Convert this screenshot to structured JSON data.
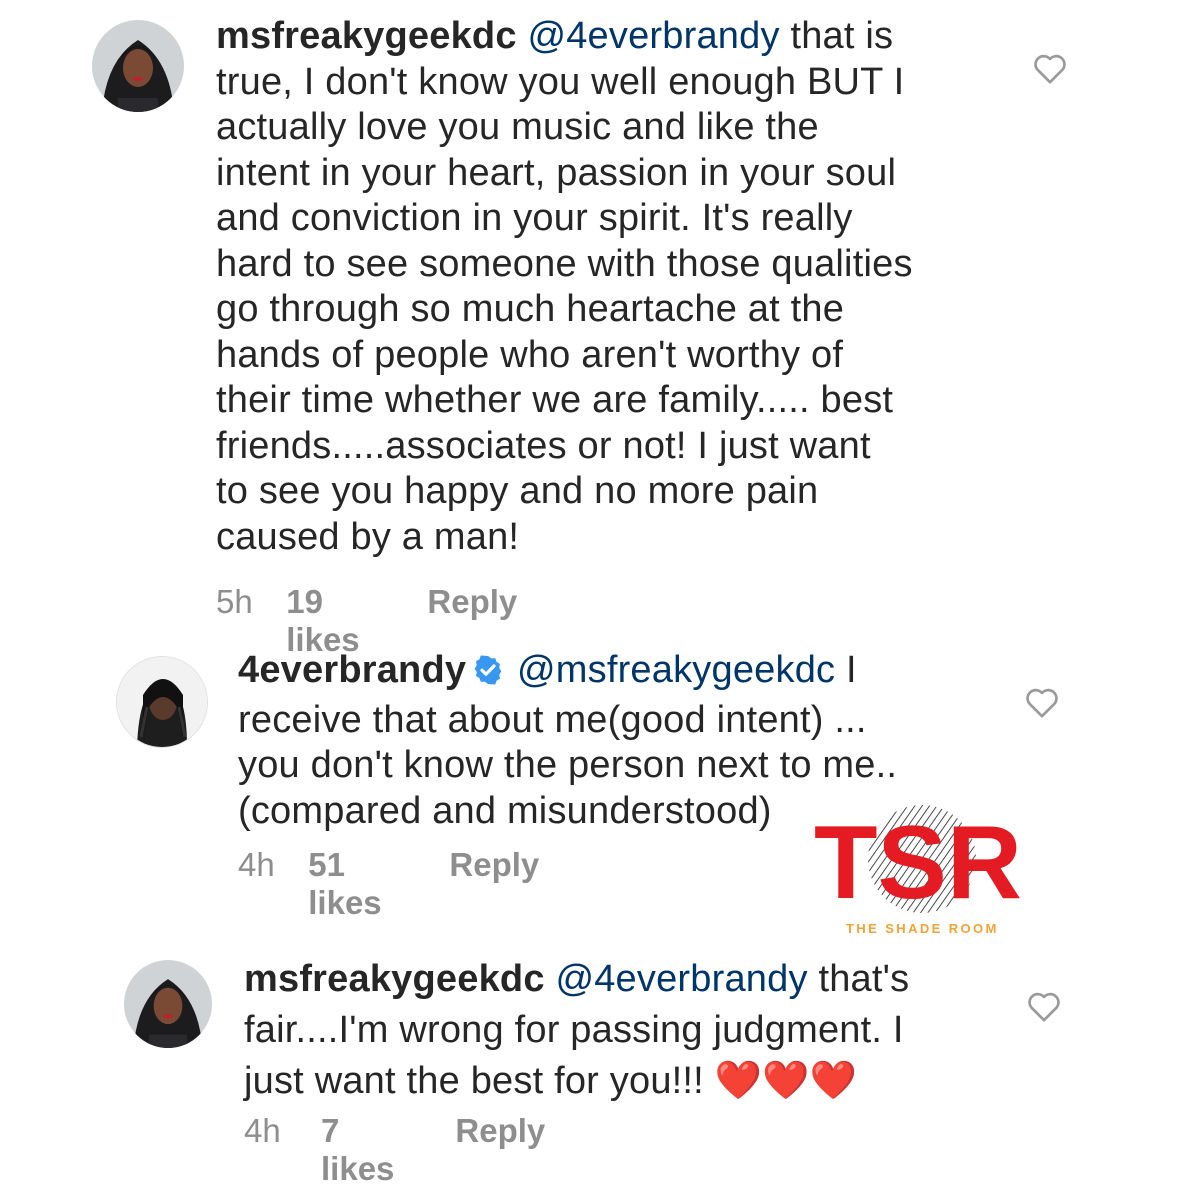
{
  "comments": [
    {
      "username": "msfreakygeekdc",
      "mention": "@4everbrandy",
      "lines": [
        "that is",
        "true, I don't know you well enough BUT I",
        "actually love you music and like the",
        "intent in your heart, passion in your soul",
        "and conviction in your spirit. It's really",
        "hard to see someone with those qualities",
        "go through so much heartache at the",
        "hands of people who aren't worthy of",
        "their time whether we are family..... best",
        "friends.....associates or not! I just want",
        "to see you happy and no more pain",
        "caused by a man!"
      ],
      "time": "5h",
      "likes": "19 likes",
      "reply": "Reply"
    },
    {
      "username": "4everbrandy",
      "verified": true,
      "mention": "@msfreakygeekdc",
      "lines": [
        "I",
        "receive that about me(good intent) ...",
        "you don't know the person next to me..",
        "(compared and misunderstood)"
      ],
      "time": "4h",
      "likes": "51 likes",
      "reply": "Reply"
    },
    {
      "username": "msfreakygeekdc",
      "mention": "@4everbrandy",
      "lines": [
        "that's",
        "fair....I'm wrong for passing judgment. I",
        "just want the best for you!!!"
      ],
      "emoji": "❤️❤️❤️",
      "time": "4h",
      "likes": "7 likes",
      "reply": "Reply"
    }
  ],
  "watermark": {
    "logo_letters": "TSR",
    "caption": "THE SHADE ROOM"
  },
  "colors": {
    "text": "#262626",
    "mention": "#003569",
    "meta": "#8e8e8e",
    "verified": "#3897f0",
    "logo_red": "#e51b23",
    "caption": "#f0a336"
  },
  "icons": {
    "like": "heart-outline-icon",
    "verified": "verified-badge-icon"
  }
}
